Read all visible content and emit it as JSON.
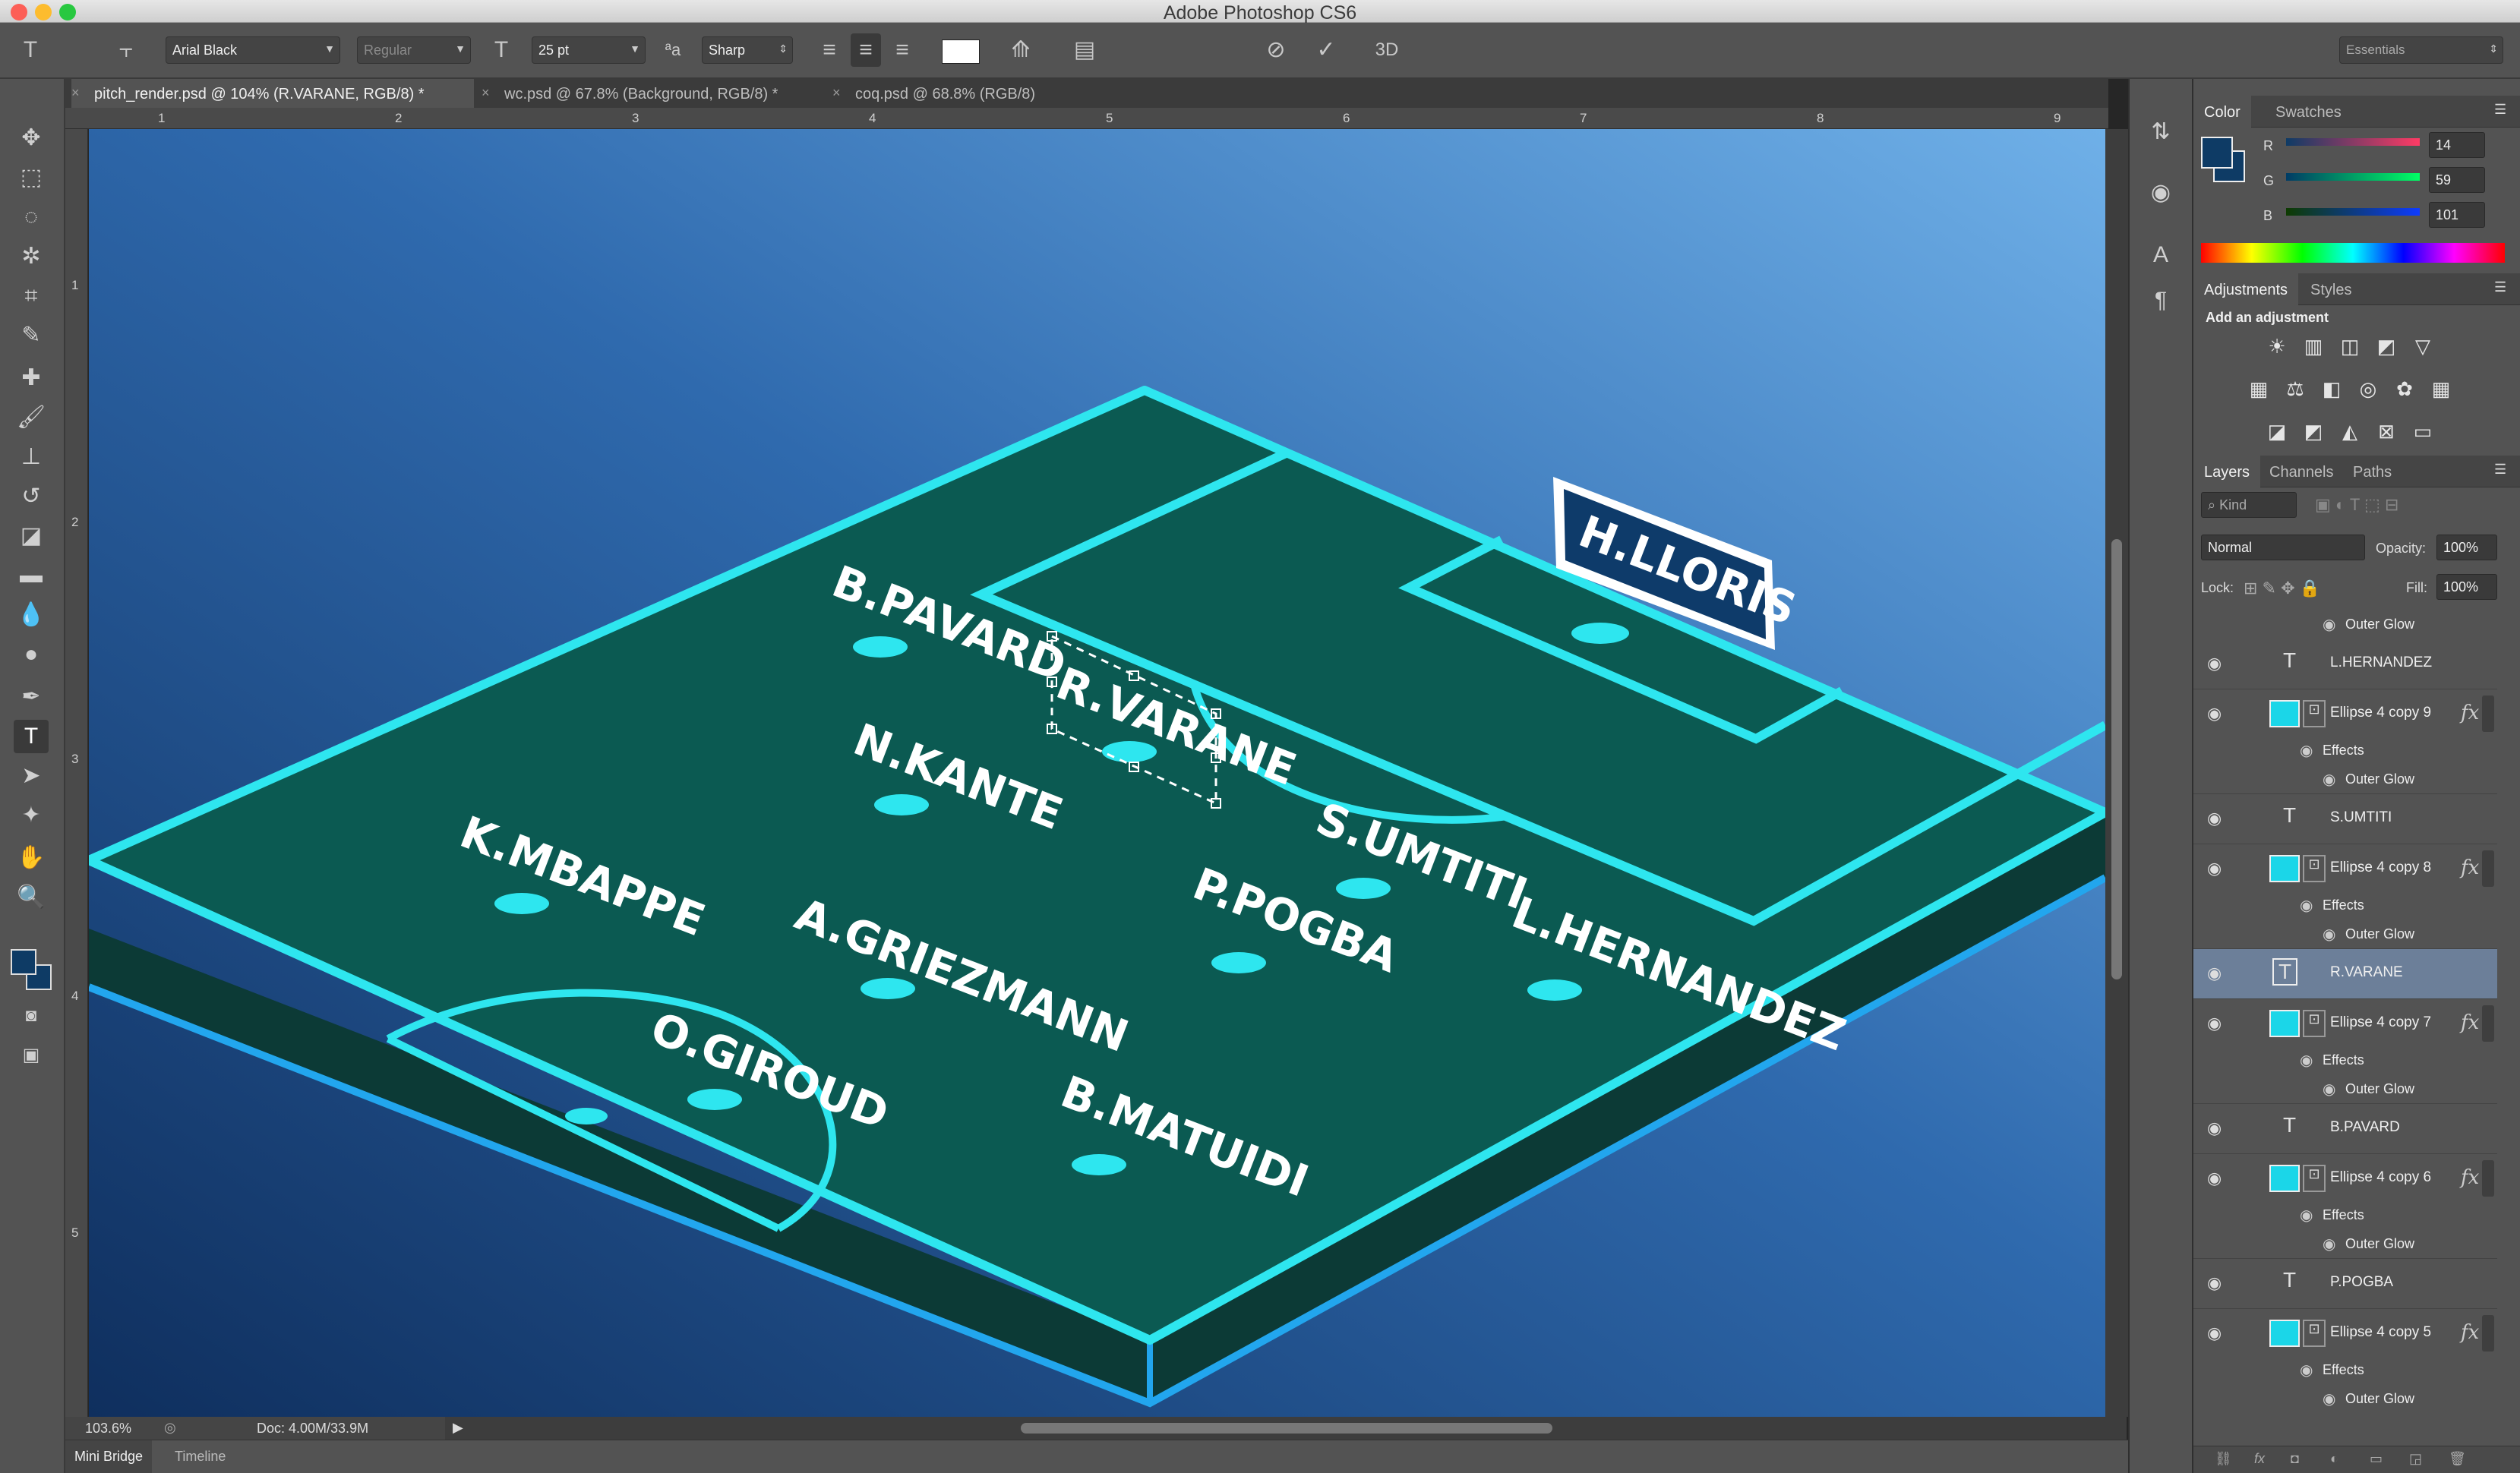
{
  "app": {
    "title": "Adobe Photoshop CS6"
  },
  "options": {
    "font_family": "Arial Black",
    "font_style": "Regular",
    "font_size": "25 pt",
    "antialias": "Sharp",
    "mode_3d": "3D",
    "workspace": "Essentials"
  },
  "tabs": [
    {
      "label": "pitch_render.psd @ 104% (R.VARANE, RGB/8) *",
      "active": true
    },
    {
      "label": "wc.psd @ 67.8% (Background, RGB/8) *",
      "active": false
    },
    {
      "label": "coq.psd @ 68.8% (RGB/8)",
      "active": false
    }
  ],
  "rulers": {
    "h": [
      "1",
      "2",
      "3",
      "4",
      "5",
      "6",
      "7",
      "8",
      "9"
    ],
    "v": [
      "1",
      "2",
      "3",
      "4",
      "5"
    ]
  },
  "canvas": {
    "players": [
      {
        "name": "H.LLORIS"
      },
      {
        "name": "B.PAVARD"
      },
      {
        "name": "R.VARANE"
      },
      {
        "name": "N.KANTE"
      },
      {
        "name": "K.MBAPPE"
      },
      {
        "name": "A.GRIEZMANN"
      },
      {
        "name": "P.POGBA"
      },
      {
        "name": "S.UMTITI"
      },
      {
        "name": "L.HERNANDEZ"
      },
      {
        "name": "O.GIROUD"
      },
      {
        "name": "B.MATUIDI"
      }
    ],
    "colors": {
      "pitch": "#0b5a52",
      "line": "#2ee6ef",
      "side": "#0d3c38",
      "bg_dark": "#123a6e",
      "bg_light": "#5fa1dc"
    }
  },
  "status": {
    "zoom": "103.6%",
    "doc": "Doc: 4.00M/33.9M"
  },
  "bottom_tabs": [
    "Mini Bridge",
    "Timeline"
  ],
  "color_panel": {
    "tabs": [
      "Color",
      "Swatches"
    ],
    "r_label": "R",
    "g_label": "G",
    "b_label": "B",
    "r": "14",
    "g": "59",
    "b": "101",
    "swatch": "#0e3b65"
  },
  "adjustments_panel": {
    "tabs": [
      "Adjustments",
      "Styles"
    ],
    "heading": "Add an adjustment"
  },
  "layers_panel": {
    "tabs": [
      "Layers",
      "Channels",
      "Paths"
    ],
    "kind": "Kind",
    "blend": "Normal",
    "opacity_label": "Opacity:",
    "opacity": "100%",
    "lock_label": "Lock:",
    "fill_label": "Fill:",
    "fill": "100%",
    "top_effect": "Outer Glow",
    "effects_label": "Effects",
    "outer_glow_label": "Outer Glow",
    "layers": [
      {
        "name": "L.HERNANDEZ",
        "kind": "text"
      },
      {
        "name": "Ellipse 4 copy 9",
        "kind": "shape"
      },
      {
        "name": "S.UMTITI",
        "kind": "text"
      },
      {
        "name": "Ellipse 4 copy 8",
        "kind": "shape"
      },
      {
        "name": "R.VARANE",
        "kind": "text",
        "selected": true
      },
      {
        "name": "Ellipse 4 copy 7",
        "kind": "shape"
      },
      {
        "name": "B.PAVARD",
        "kind": "text"
      },
      {
        "name": "Ellipse 4 copy 6",
        "kind": "shape"
      },
      {
        "name": "P.POGBA",
        "kind": "text"
      },
      {
        "name": "Ellipse 4 copy 5",
        "kind": "shape"
      }
    ]
  }
}
